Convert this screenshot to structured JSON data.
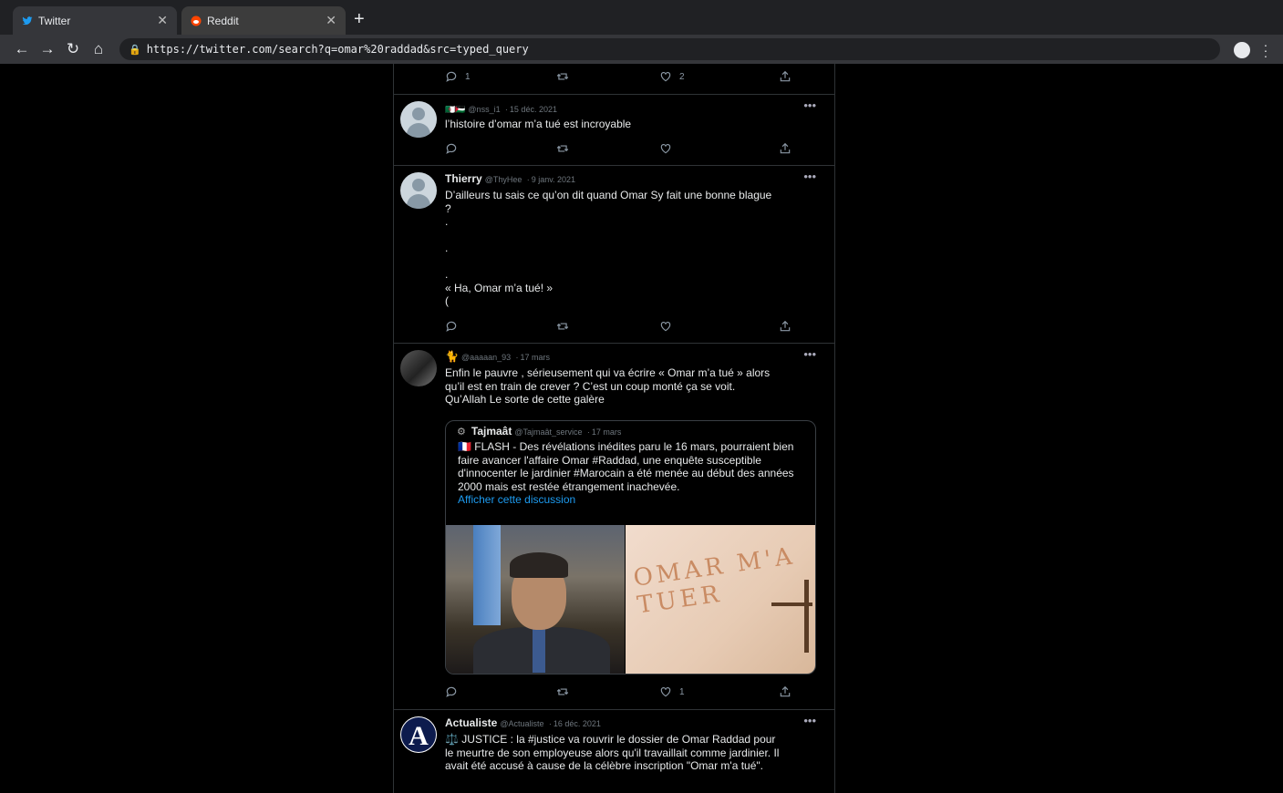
{
  "browser": {
    "tabs": [
      {
        "label": "Twitter",
        "icon": "twitter-bird-icon",
        "active": true
      },
      {
        "label": "Reddit",
        "icon": "reddit-icon",
        "active": false
      }
    ],
    "url": "https://twitter.com/search?q=omar%20raddad&src=typed_query"
  },
  "tweets": [
    {
      "actions": {
        "reply": "1",
        "retweet": "",
        "like": "2"
      }
    },
    {
      "name": "🇩🇿🇵🇸",
      "handle": "@nss_i1",
      "dot": "·",
      "date": "15 déc. 2021",
      "text": "l’histoire d’omar m’a tué est incroyable",
      "actions": {
        "reply": "",
        "retweet": "",
        "like": ""
      }
    },
    {
      "name": "Thierry",
      "handle": "@ThyHee",
      "dot": "·",
      "date": "9 janv. 2021",
      "text": "D’ailleurs tu sais ce qu’on dit quand Omar Sy fait une bonne blague\n?\n.\n\n.\n\n.\n« Ha, Omar m’a tué! »\n(",
      "actions": {
        "reply": "",
        "retweet": "",
        "like": ""
      }
    },
    {
      "name": "🐈",
      "handle": "@aaaaan_93",
      "dot": "·",
      "date": "17 mars",
      "text": "Enfin le pauvre , sérieusement qui va écrire « Omar m’a tué » alors qu’il est en train de crever ? C’est un coup monté ça se voit.\nQu’Allah Le sorte de cette galère",
      "quote": {
        "name": "Tajmaât",
        "handle": "@Tajmaât_service",
        "dot": "·",
        "date": "17 mars",
        "text": "🇫🇷 FLASH - Des révélations inédites paru le 16 mars, pourraient bien faire avancer l'affaire Omar #Raddad, une enquête susceptible d'innocenter le jardinier #Marocain a été menée au début des années 2000 mais est restée étrangement inachevée.",
        "link": "Afficher cette discussion",
        "image_graffiti": "OMAR M'A TUER"
      },
      "actions": {
        "reply": "",
        "retweet": "",
        "like": "1"
      }
    },
    {
      "name": "Actualiste",
      "handle": "@Actualiste",
      "dot": "·",
      "date": "16 déc. 2021",
      "text": "⚖️ JUSTICE : la #justice va rouvrir le dossier de Omar Raddad pour le meurtre de son employeuse alors qu'il travaillait comme jardinier. Il avait été accusé à cause de la célèbre inscription \"Omar m'a tué\".",
      "avatar_letter": "A"
    }
  ],
  "more_label": "•••"
}
